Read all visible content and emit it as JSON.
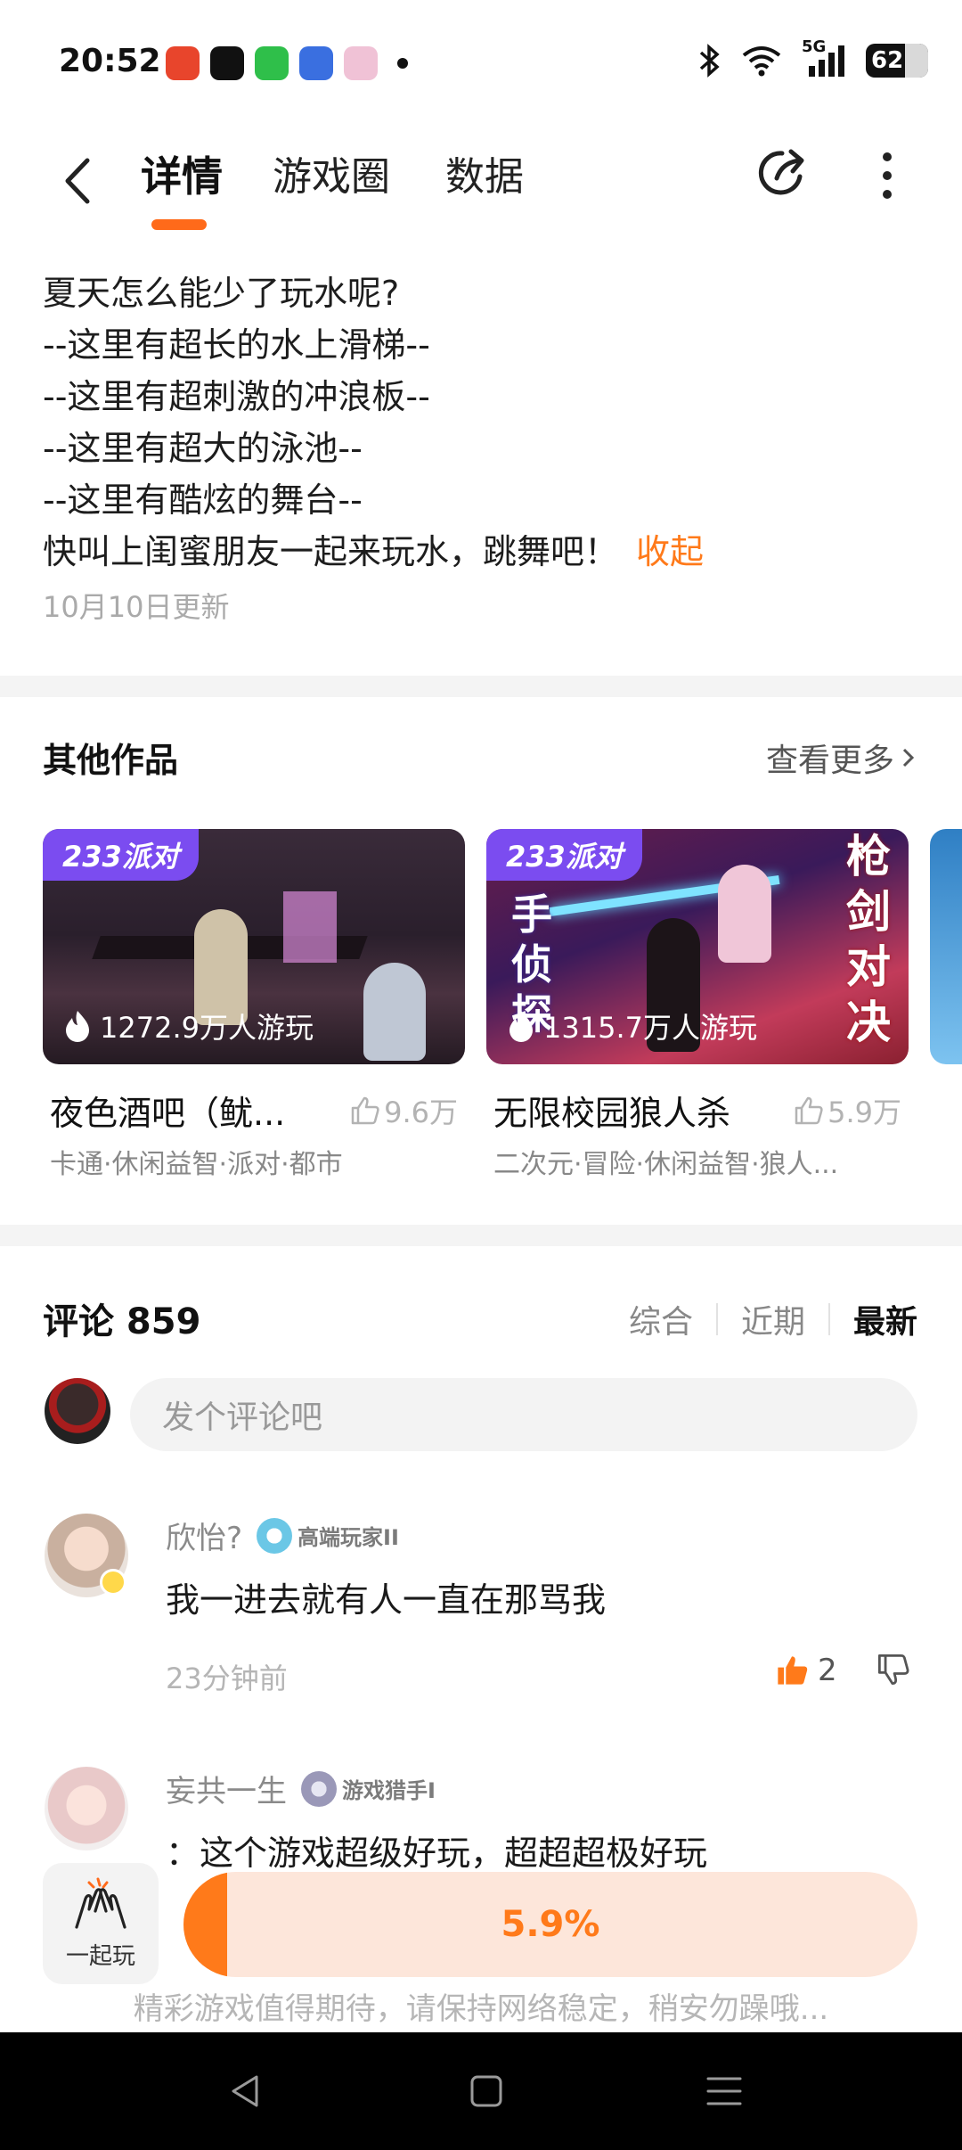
{
  "status_bar": {
    "time": "20:52",
    "battery": "62",
    "network": "5G"
  },
  "nav": {
    "tabs": [
      "详情",
      "游戏圈",
      "数据"
    ],
    "active_tab": "详情"
  },
  "description": {
    "lines": [
      "夏天怎么能少了玩水呢?",
      "--这里有超长的水上滑梯--",
      "--这里有超刺激的冲浪板--",
      "--这里有超大的泳池--",
      "--这里有酷炫的舞台--",
      "快叫上闺蜜朋友一起来玩水，跳舞吧！"
    ],
    "collapse": "收起",
    "updated": "10月10日更新"
  },
  "other_works": {
    "title": "其他作品",
    "see_more": "查看更多",
    "cards": [
      {
        "badge": "233派对",
        "plays": "1272.9万人游玩",
        "name": "夜色酒吧（鱿...",
        "likes": "9.6万",
        "tags": "卡通·休闲益智·派对·都市"
      },
      {
        "badge": "233派对",
        "plays": "1315.7万人游玩",
        "name": "无限校园狼人杀",
        "likes": "5.9万",
        "tags": "二次元·冒险·休闲益智·狼人...",
        "overlay_left": "手侦探",
        "overlay_right": "枪剑对决"
      }
    ]
  },
  "comments": {
    "title": "评论 859",
    "sort": [
      "综合",
      "近期",
      "最新"
    ],
    "active_sort": "最新",
    "input_placeholder": "发个评论吧",
    "items": [
      {
        "user": "欣怡?",
        "badge": "高端玩家II",
        "text": "我一进去就有人一直在那骂我",
        "time": "23分钟前",
        "likes": "2"
      },
      {
        "user": "妄共一生",
        "badge": "游戏猎手I",
        "text": "：这个游戏超级好玩，超超超极好玩"
      }
    ]
  },
  "bottom": {
    "together_label": "一起玩",
    "progress_label": "5.9%",
    "progress_value": 0.059,
    "tip": "精彩游戏值得期待，请保持网络稳定，稍安勿躁哦..."
  },
  "colors": {
    "accent": "#ff7a1a",
    "badge_purple": "#7b4cf0",
    "progress_bg": "#fde6da"
  }
}
